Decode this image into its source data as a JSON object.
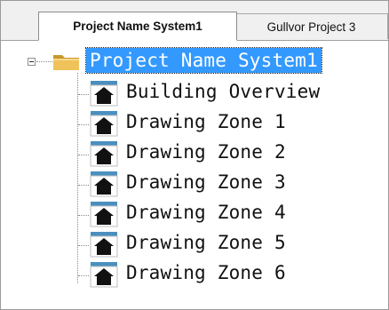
{
  "tabs": [
    {
      "label": "Project Name System1",
      "active": true
    },
    {
      "label": "Gullvor Project 3",
      "active": false
    }
  ],
  "tree": {
    "root": {
      "label": "Project Name System1",
      "expanded": true,
      "selected": true,
      "icon": "folder-icon"
    },
    "children": [
      {
        "label": "Building Overview",
        "icon": "house-icon"
      },
      {
        "label": "Drawing Zone 1",
        "icon": "house-icon"
      },
      {
        "label": "Drawing Zone 2",
        "icon": "house-icon"
      },
      {
        "label": "Drawing Zone 3",
        "icon": "house-icon"
      },
      {
        "label": "Drawing Zone 4",
        "icon": "house-icon"
      },
      {
        "label": "Drawing Zone 5",
        "icon": "house-icon"
      },
      {
        "label": "Drawing Zone 6",
        "icon": "house-icon"
      }
    ]
  },
  "colors": {
    "selection": "#3399ff",
    "folder": "#e8b84a",
    "icon_tab": "#4a8fbf"
  }
}
